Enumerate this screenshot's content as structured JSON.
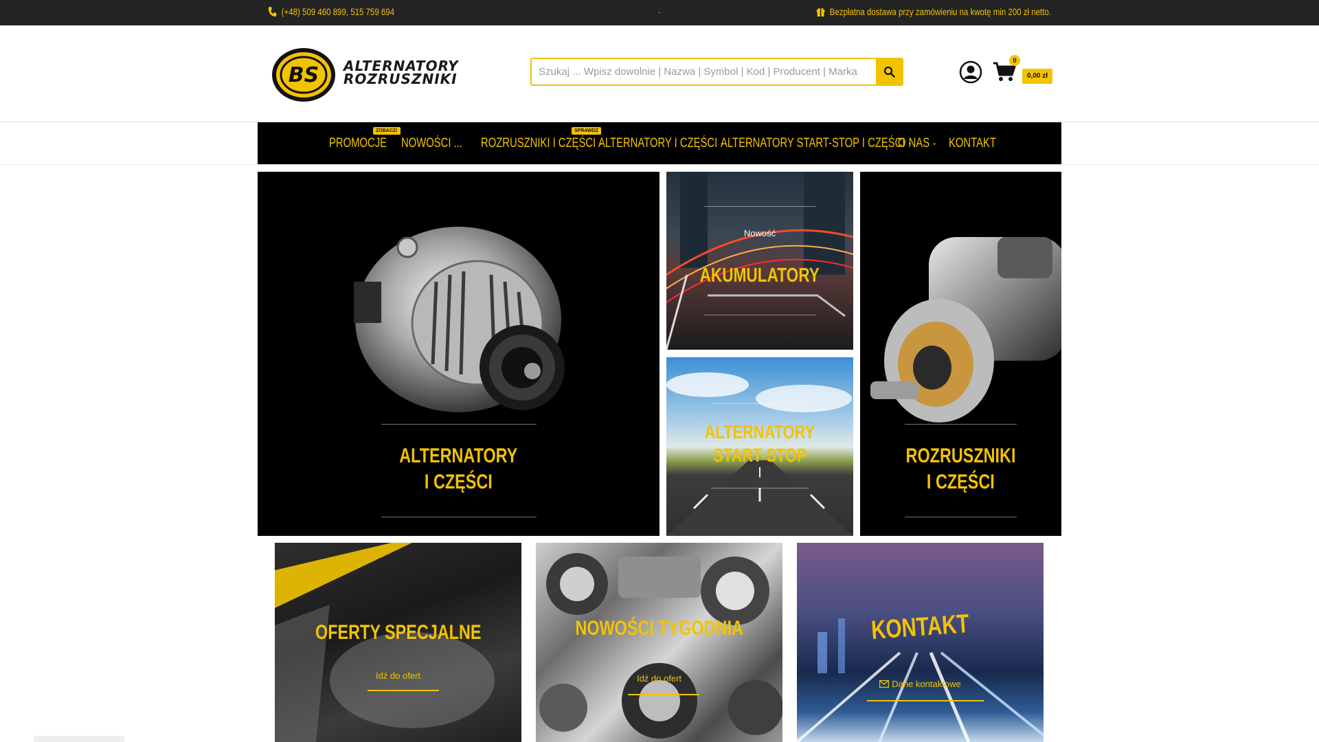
{
  "topbar": {
    "phone": "(+48) 509 460 899, 515 759 694",
    "separator": ".",
    "shipping": "Bezpłatna dostawa przy zamówieniu na kwotę min 200 zł netto.",
    "phone_icon": "phone-icon",
    "gift_icon": "gift-icon"
  },
  "header": {
    "logo_monogram": "BS",
    "logo_line1": "ALTERNATORY",
    "logo_line2": "ROZRUSZNIKI",
    "search_placeholder": "Szukaj ... Wpisz dowolnie | Nazwa | Symbol | Kod | Producent | Marka",
    "cart_count": "0",
    "cart_total": "0,00 zł"
  },
  "nav": {
    "items": [
      {
        "label": "PROMOCJE",
        "badge": "ZOBACZ!"
      },
      {
        "label": "NOWOŚCI ..."
      },
      {
        "label": "ROZRUSZNIKI I CZĘŚCI",
        "badge": "SPRAWDŹ"
      },
      {
        "label": "ALTERNATORY I CZĘŚCI"
      },
      {
        "label": "ALTERNATORY START-STOP I CZĘŚCI"
      },
      {
        "label": "O NAS"
      },
      {
        "label": "KONTAKT"
      }
    ]
  },
  "tiles": {
    "alternatory": {
      "line1": "ALTERNATORY",
      "line2": "I CZĘŚCI"
    },
    "akumulatory": {
      "pre": "Nowość",
      "title": "AKUMULATORY"
    },
    "startstop": {
      "line1": "ALTERNATORY",
      "line2": "START-STOP"
    },
    "rozruszniki": {
      "line1": "ROZRUSZNIKI",
      "line2": "I CZĘŚCI"
    },
    "oferty": {
      "title": "OFERTY SPECJALNE",
      "link": "Idź do ofert"
    },
    "nowosci": {
      "title": "NOWOŚCI TYGODNIA",
      "link": "Idź do ofert"
    },
    "kontakt": {
      "title": "KONTAKT",
      "link": "Dane kontaktowe"
    }
  },
  "colors": {
    "accent": "#f2c300",
    "topbar": "#232323",
    "nav": "#000000"
  }
}
